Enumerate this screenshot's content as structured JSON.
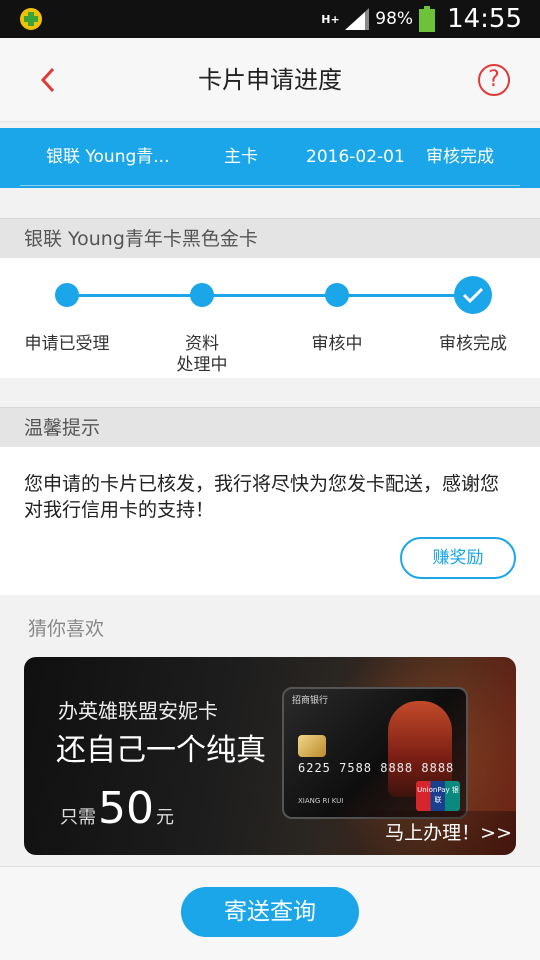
{
  "status_bar": {
    "network": "H+",
    "battery": "98%",
    "time": "14:55"
  },
  "header": {
    "title": "卡片申请进度",
    "help_label": "?"
  },
  "summary": {
    "card_name": "银联 Young青...",
    "card_type": "主卡",
    "date": "2016-02-01",
    "status": "审核完成"
  },
  "card_section": {
    "title": "银联 Young青年卡黑色金卡",
    "steps": [
      {
        "line1": "申请已受理",
        "line2": ""
      },
      {
        "line1": "资料",
        "line2": "处理中"
      },
      {
        "line1": "审核中",
        "line2": ""
      },
      {
        "line1": "审核完成",
        "line2": ""
      }
    ]
  },
  "tips": {
    "title": "温馨提示",
    "text": "您申请的卡片已核发，我行将尽快为您发卡配送，感谢您对我行信用卡的支持！",
    "reward_button": "赚奖励"
  },
  "recommend": {
    "title": "猜你喜欢",
    "banner": {
      "line1": "办英雄联盟安妮卡",
      "line2": "还自己一个纯真",
      "price_prefix": "只需",
      "price_value": "50",
      "price_unit": "元",
      "cta": "马上办理！>>",
      "card_bank": "招商银行",
      "card_number": "6225 7588 8888 8888",
      "card_holder": "XIANG RI KUI",
      "unionpay_label": "UnionPay 银联"
    }
  },
  "footer": {
    "button": "寄送查询"
  },
  "colors": {
    "accent": "#1aa6e8",
    "header_icon": "#e03a3a"
  }
}
